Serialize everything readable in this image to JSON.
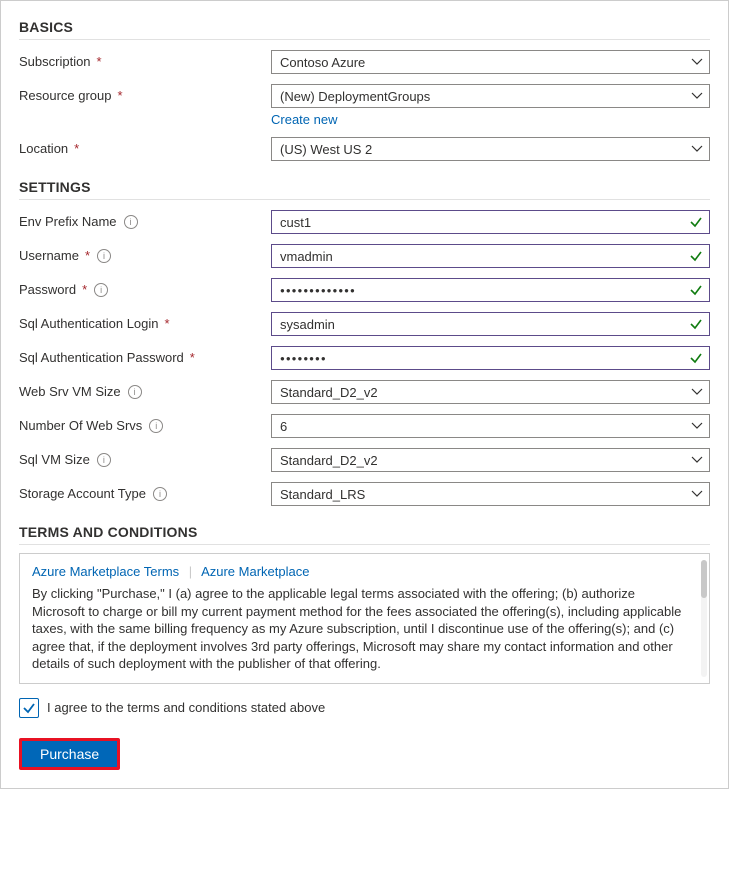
{
  "sections": {
    "basics": "BASICS",
    "settings": "SETTINGS",
    "terms": "TERMS AND CONDITIONS"
  },
  "basics": {
    "subscription_label": "Subscription",
    "subscription_value": "Contoso Azure",
    "resource_group_label": "Resource group",
    "resource_group_value": "(New) DeploymentGroups",
    "create_new_link": "Create new",
    "location_label": "Location",
    "location_value": "(US) West US 2"
  },
  "settings": {
    "env_prefix_label": "Env Prefix Name",
    "env_prefix_value": "cust1",
    "username_label": "Username",
    "username_value": "vmadmin",
    "password_label": "Password",
    "password_value": "●●●●●●●●●●●●●",
    "sql_login_label": "Sql Authentication Login",
    "sql_login_value": "sysadmin",
    "sql_password_label": "Sql Authentication Password",
    "sql_password_value": "●●●●●●●●",
    "web_vm_size_label": "Web Srv VM Size",
    "web_vm_size_value": "Standard_D2_v2",
    "num_web_srvs_label": "Number Of Web Srvs",
    "num_web_srvs_value": "6",
    "sql_vm_size_label": "Sql VM Size",
    "sql_vm_size_value": "Standard_D2_v2",
    "storage_type_label": "Storage Account Type",
    "storage_type_value": "Standard_LRS"
  },
  "terms": {
    "tab1": "Azure Marketplace Terms",
    "tab2": "Azure Marketplace",
    "body": "By clicking \"Purchase,\" I (a) agree to the applicable legal terms associated with the offering; (b) authorize Microsoft to charge or bill my current payment method for the fees associated the offering(s), including applicable taxes, with the same billing frequency as my Azure subscription, until I discontinue use of the offering(s); and (c) agree that, if the deployment involves 3rd party offerings, Microsoft may share my contact information and other details of such deployment with the publisher of that offering."
  },
  "agree_label": "I agree to the terms and conditions stated above",
  "purchase_label": "Purchase"
}
